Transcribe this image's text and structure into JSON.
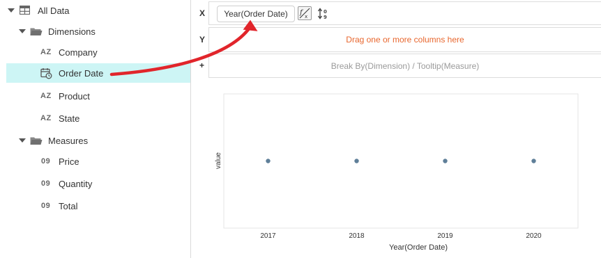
{
  "tree": {
    "root": {
      "label": "All Data",
      "icon": "table-grid-icon"
    },
    "dimensions": {
      "label": "Dimensions",
      "icon": "folder-icon",
      "items": [
        {
          "badge": "AZ",
          "label": "Company"
        },
        {
          "badge": "",
          "icon": "calendar-date-icon",
          "label": "Order Date",
          "selected": true
        },
        {
          "badge": "AZ",
          "label": "Product"
        },
        {
          "badge": "AZ",
          "label": "State"
        }
      ]
    },
    "measures": {
      "label": "Measures",
      "icon": "folder-icon",
      "items": [
        {
          "badge": "09",
          "label": "Price"
        },
        {
          "badge": "09",
          "label": "Quantity"
        },
        {
          "badge": "09",
          "label": "Total"
        }
      ]
    }
  },
  "shelves": {
    "x": {
      "letter": "X",
      "pill": "Year(Order Date)",
      "function_icon": "function-edit-icon",
      "sort_icon": "sort-icon"
    },
    "y": {
      "letter": "Y",
      "placeholder": "Drag one or more columns here"
    },
    "breakby": {
      "letter": "+",
      "placeholder": "Break By(Dimension) / Tooltip(Measure)"
    }
  },
  "colors": {
    "selected_row": "#cdf5f5",
    "hint_orange": "#e8662d",
    "point": "#5f7f99",
    "arrow": "#e1252b"
  },
  "chart_data": {
    "type": "scatter",
    "categories": [
      "2017",
      "2018",
      "2019",
      "2020"
    ],
    "values": [
      0,
      0,
      0,
      0
    ],
    "xlabel": "Year(Order Date)",
    "ylabel": "value",
    "title": "",
    "grid": false
  }
}
